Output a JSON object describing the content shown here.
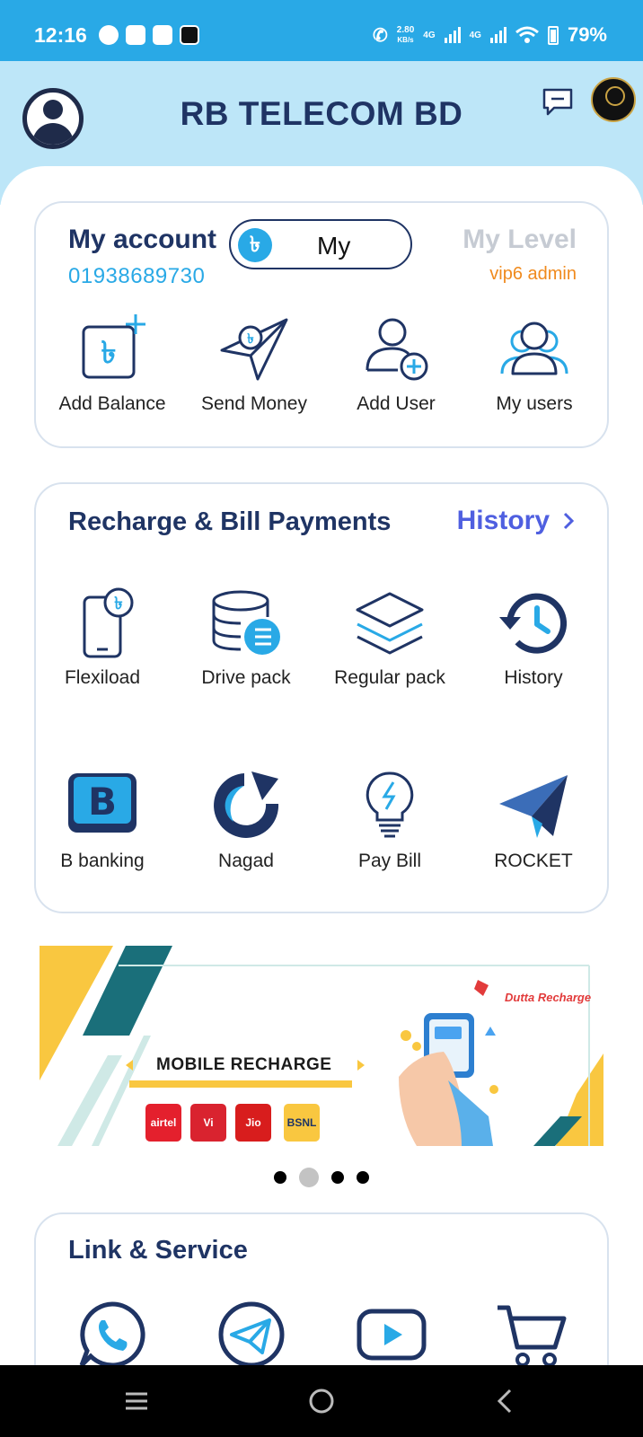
{
  "status_bar": {
    "time": "12:16",
    "speed_value": "2.80",
    "speed_unit": "KB/s",
    "network_1": "4G",
    "network_2": "4G",
    "battery": "79%"
  },
  "header": {
    "title": "RB TELECOM BD",
    "icons": {
      "profile": "user-avatar-icon",
      "chat": "chat-bubble-icon",
      "logo": "brand-logo"
    }
  },
  "account": {
    "title": "My account",
    "phone": "01938689730",
    "toggle_symbol": "৳",
    "toggle_label": "My",
    "level_title": "My Level",
    "level_value": "vip6 admin",
    "actions": [
      {
        "label": "Add Balance",
        "icon": "wallet-add-icon"
      },
      {
        "label": "Send Money",
        "icon": "paper-plane-coin-icon"
      },
      {
        "label": "Add User",
        "icon": "add-user-icon"
      },
      {
        "label": "My users",
        "icon": "users-group-icon"
      }
    ]
  },
  "recharge": {
    "title": "Recharge & Bill Payments",
    "history_link": "History",
    "items": [
      {
        "label": "Flexiload",
        "icon": "phone-taka-icon"
      },
      {
        "label": "Drive pack",
        "icon": "database-list-icon"
      },
      {
        "label": "Regular pack",
        "icon": "layers-icon"
      },
      {
        "label": "History",
        "icon": "history-clock-icon"
      },
      {
        "label": "B banking",
        "icon": "b-banking-icon"
      },
      {
        "label": "Nagad",
        "icon": "nagad-icon"
      },
      {
        "label": "Pay Bill",
        "icon": "bulb-bill-icon"
      },
      {
        "label": "ROCKET",
        "icon": "rocket-plane-icon"
      }
    ]
  },
  "banner": {
    "title": "MOBILE RECHARGE",
    "brand": "Dutta Recharge",
    "operators": [
      "airtel",
      "Vi",
      "Jio",
      "BSNL"
    ],
    "colors": {
      "yellow": "#f9c740",
      "teal": "#1a6f7a"
    }
  },
  "carousel": {
    "slides": 4,
    "active": 2
  },
  "links": {
    "title": "Link & Service",
    "items": [
      "whatsapp-icon",
      "telegram-icon",
      "youtube-icon",
      "cart-icon"
    ]
  },
  "colors": {
    "accent": "#29a9e6",
    "navy": "#1f3464",
    "orange": "#f08a1d",
    "link_blue": "#4f5fe0"
  }
}
